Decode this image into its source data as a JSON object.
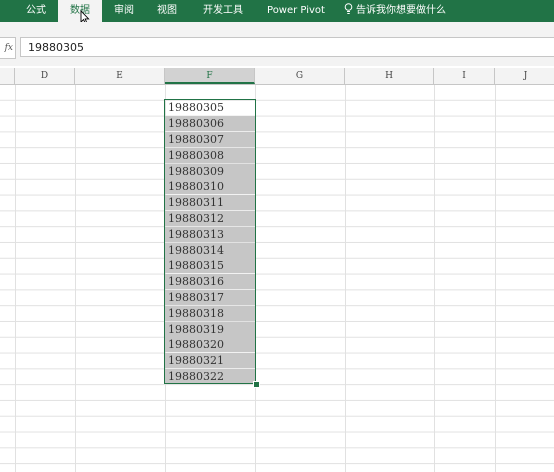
{
  "ribbon": {
    "tabs": [
      {
        "label": "",
        "name": "tab-partial"
      },
      {
        "label": "公式",
        "name": "tab-formulas"
      },
      {
        "label": "数据",
        "name": "tab-data",
        "active": true
      },
      {
        "label": "审阅",
        "name": "tab-review"
      },
      {
        "label": "视图",
        "name": "tab-view"
      },
      {
        "label": "开发工具",
        "name": "tab-developer"
      },
      {
        "label": "Power Pivot",
        "name": "tab-power-pivot"
      }
    ],
    "tell_me": "告诉我你想要做什么",
    "tell_me_icon": "lightbulb-icon",
    "colors": {
      "ribbon": "#217346",
      "active_tab_bg": "#f3f3f3"
    }
  },
  "formula_bar": {
    "fx_label": "fx",
    "value": "19880305"
  },
  "columns": [
    "D",
    "E",
    "F",
    "G",
    "H",
    "I",
    "J"
  ],
  "selected_column": "F",
  "cells": [
    "19880305",
    "19880306",
    "19880307",
    "19880308",
    "19880309",
    "19880310",
    "19880311",
    "19880312",
    "19880313",
    "19880314",
    "19880315",
    "19880316",
    "19880317",
    "19880318",
    "19880319",
    "19880320",
    "19880321",
    "19880322"
  ]
}
